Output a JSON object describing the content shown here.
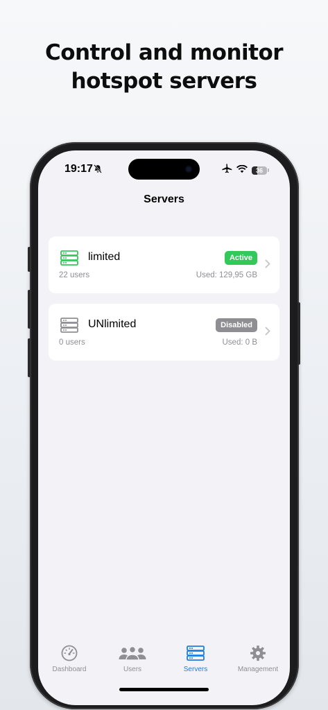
{
  "headline": {
    "line1": "Control and monitor",
    "line2": "hotspot servers"
  },
  "status_bar": {
    "time": "19:17",
    "battery": "36",
    "battery_level": 0.36,
    "icons": [
      "bell-slash-icon",
      "airplane-icon",
      "wifi-icon",
      "battery-icon"
    ]
  },
  "nav": {
    "title": "Servers"
  },
  "servers": [
    {
      "name": "limited",
      "status": "Active",
      "status_color": "#34c759",
      "icon_color": "#34c759",
      "users": "22 users",
      "used": "Used: 129,95 GB"
    },
    {
      "name": "UNlimited",
      "status": "Disabled",
      "status_color": "#8e8e93",
      "icon_color": "#8e8e93",
      "users": "0 users",
      "used": "Used: 0 B"
    }
  ],
  "tabs": [
    {
      "label": "Dashboard",
      "icon": "speedometer-icon",
      "active": false
    },
    {
      "label": "Users",
      "icon": "users-icon",
      "active": false
    },
    {
      "label": "Servers",
      "icon": "server-rack-icon",
      "active": true
    },
    {
      "label": "Management",
      "icon": "gear-icon",
      "active": false
    }
  ],
  "colors": {
    "accent": "#1a7ee6",
    "active_green": "#34c759",
    "disabled_gray": "#8e8e93",
    "inactive_tab": "#8e8e93"
  }
}
